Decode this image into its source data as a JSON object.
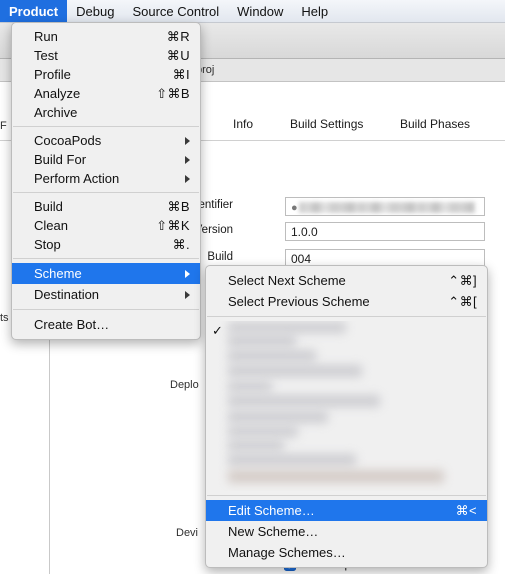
{
  "menubar": {
    "items": [
      {
        "label": "Product",
        "active": true
      },
      {
        "label": "Debug",
        "active": false
      },
      {
        "label": "Source Control",
        "active": false
      },
      {
        "label": "Window",
        "active": false
      },
      {
        "label": "Help",
        "active": false
      }
    ]
  },
  "product_menu": {
    "groups": [
      {
        "items": [
          {
            "label": "Run",
            "shortcut": "⌘R"
          },
          {
            "label": "Test",
            "shortcut": "⌘U"
          },
          {
            "label": "Profile",
            "shortcut": "⌘I"
          },
          {
            "label": "Analyze",
            "shortcut": "⇧⌘B"
          },
          {
            "label": "Archive",
            "shortcut": ""
          }
        ]
      },
      {
        "items": [
          {
            "label": "CocoaPods",
            "shortcut": "",
            "submenu": true
          },
          {
            "label": "Build For",
            "shortcut": "",
            "submenu": true
          },
          {
            "label": "Perform Action",
            "shortcut": "",
            "submenu": true
          }
        ]
      },
      {
        "items": [
          {
            "label": "Build",
            "shortcut": "⌘B"
          },
          {
            "label": "Clean",
            "shortcut": "⇧⌘K"
          },
          {
            "label": "Stop",
            "shortcut": "⌘."
          }
        ]
      },
      {
        "items": [
          {
            "label": "Scheme",
            "shortcut": "",
            "submenu": true,
            "highlighted": true
          },
          {
            "label": "Destination",
            "shortcut": "",
            "submenu": true
          }
        ]
      },
      {
        "items": [
          {
            "label": "Create Bot…",
            "shortcut": ""
          }
        ]
      }
    ]
  },
  "scheme_submenu": {
    "top_items": [
      {
        "label": "Select Next Scheme",
        "shortcut": "⌃⌘]"
      },
      {
        "label": "Select Previous Scheme",
        "shortcut": "⌃⌘["
      }
    ],
    "scheme_list_redacted": true,
    "scheme_list_checkmark": "✓",
    "bottom_items": [
      {
        "label": "Edit Scheme…",
        "shortcut": "⌘<",
        "highlighted": true
      },
      {
        "label": "New Scheme…",
        "shortcut": ""
      },
      {
        "label": "Manage Schemes…",
        "shortcut": ""
      }
    ]
  },
  "background": {
    "breadcrumb": "proj",
    "tabs": [
      {
        "label": "Info"
      },
      {
        "label": "Build Settings"
      },
      {
        "label": "Build Phases"
      }
    ],
    "fields": [
      {
        "label": "ndle Identifier",
        "value": "",
        "redacted": true
      },
      {
        "label": "Version",
        "value": "1.0.0",
        "redacted": false
      },
      {
        "label": "Build",
        "value": "004",
        "redacted": false
      }
    ],
    "left_fragments": [
      {
        "text": "F"
      },
      {
        "text": "ts"
      },
      {
        "text": "Deplo"
      },
      {
        "text": "Devi"
      }
    ],
    "orientation_checkbox": {
      "label": "Landscape Left",
      "checked": true
    }
  },
  "colors": {
    "menu_highlight": "#1f76ec",
    "menubar_active": "#1f6fe0",
    "checkbox_blue": "#1a6fe0"
  }
}
